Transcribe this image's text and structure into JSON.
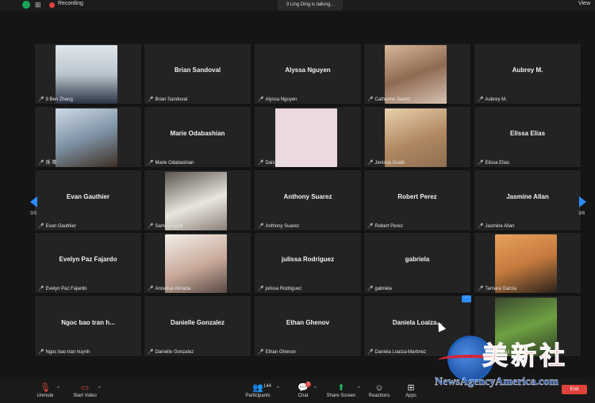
{
  "topbar": {
    "recording_label": "Recording",
    "view_label": "View"
  },
  "talking": "3 Ling Ding is talking...",
  "pagination": {
    "left": "3/5",
    "right": "3/6"
  },
  "participants": [
    {
      "label": "9 Ben Zhang",
      "photo": true
    },
    {
      "name": "Brian Sandoval",
      "label": "Brian Sandoval"
    },
    {
      "name": "Alyssa Nguyen",
      "label": "Alyssa Nguyen"
    },
    {
      "label": "Catherine Saenz",
      "photo": true
    },
    {
      "name": "Aubrey M.",
      "label": "Aubrey M."
    },
    {
      "label": "孫 偉",
      "photo": true
    },
    {
      "name": "Marie Odabashian",
      "label": "Marie Odabashian"
    },
    {
      "label": "Daisy Ayala",
      "photo": true
    },
    {
      "label": "Jenissa Guido",
      "photo": true
    },
    {
      "name": "Elissa Elias",
      "label": "Elissa Elias"
    },
    {
      "name": "Evan Gauthier",
      "label": "Evan Gauthier"
    },
    {
      "label": "Samira Ayyat",
      "photo": true
    },
    {
      "name": "Anthony Suarez",
      "label": "Anthony Suarez"
    },
    {
      "name": "Robert Perez",
      "label": "Robert Perez"
    },
    {
      "name": "Jasmine Allan",
      "label": "Jasmine Allan"
    },
    {
      "name": "Evelyn Paz Fajardo",
      "label": "Evelyn Paz Fajardo"
    },
    {
      "label": "Annalisa Almada",
      "photo": true
    },
    {
      "name": "julissa Rodriguez",
      "label": "julissa Rodriguez"
    },
    {
      "name": "gabriela",
      "label": "gabriela"
    },
    {
      "label": "Tamara Garcia",
      "photo": true
    },
    {
      "name": "Ngoc bao tran h...",
      "label": "Ngoc bao tran huynh"
    },
    {
      "name": "Danielle Gonzalez",
      "label": "Danielle Gonzalez"
    },
    {
      "name": "Ethan Ghenov",
      "label": "Ethan Ghenov"
    },
    {
      "name": "Daniela Loaiza...",
      "label": "Daniela Loaiza-Martinez"
    },
    {
      "label": "Andy Perez",
      "photo": true
    }
  ],
  "toolbar": {
    "unmute": "Unmute",
    "start_video": "Start Video",
    "participants": "Participants",
    "participants_count": "144",
    "chat": "Chat",
    "chat_badge": "2",
    "share_screen": "Share Screen",
    "reactions": "Reactions",
    "apps": "Apps",
    "end": "End"
  },
  "watermark": {
    "chinese": "美新社",
    "url": "NewsAgencyAmerica.com"
  },
  "colors": {
    "accent": "#2d8cff",
    "muted": "#e04a3b",
    "share": "#1bbf5d"
  }
}
